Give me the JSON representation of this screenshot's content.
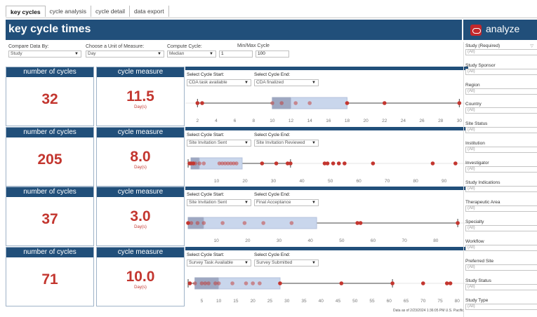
{
  "tabs": [
    "key cycles",
    "cycle analysis",
    "cycle detail",
    "data export"
  ],
  "header": {
    "title": "key cycle times"
  },
  "brand": {
    "name": "analyze"
  },
  "filters": {
    "compare_label": "Compare Data By:",
    "compare_value": "Study",
    "unit_label": "Choose a Unit of Measure:",
    "unit_value": "Day",
    "compute_label": "Compute Cycle:",
    "compute_value": "Median",
    "minmax_label": "Min/Max Cycle",
    "min_value": "1",
    "max_value": "100"
  },
  "labels": {
    "count_header": "number of cycles",
    "measure_header": "cycle measure",
    "unit": "Day(s)",
    "start_label": "Select Cycle Start:",
    "end_label": "Select Cycle End:"
  },
  "rows": [
    {
      "count": "32",
      "measure": "11.5",
      "start": "CDA task available",
      "end": "CDA finalized",
      "axis": {
        "min": 1,
        "max": 30.5,
        "ticks": [
          2,
          4,
          6,
          8,
          10,
          12,
          14,
          16,
          18,
          20,
          22,
          24,
          26,
          28,
          30
        ]
      },
      "box": {
        "whisker_low": 2,
        "q1": 10,
        "median": 12,
        "q3": 18,
        "whisker_high": 30
      },
      "points": [
        {
          "x": 2,
          "o": false
        },
        {
          "x": 2.5,
          "o": false
        },
        {
          "x": 10,
          "o": true
        },
        {
          "x": 11,
          "o": true
        },
        {
          "x": 12.5,
          "o": true
        },
        {
          "x": 14,
          "o": true
        },
        {
          "x": 18,
          "o": false
        },
        {
          "x": 22,
          "o": false
        },
        {
          "x": 30,
          "o": false
        }
      ]
    },
    {
      "count": "205",
      "measure": "8.0",
      "start": "Site Invitation Sent",
      "end": "Site Invitation Reviewed",
      "axis": {
        "min": 0,
        "max": 97,
        "ticks": [
          10,
          20,
          30,
          40,
          50,
          60,
          70,
          80,
          90
        ]
      },
      "box": {
        "whisker_low": 0,
        "q1": 1,
        "median": 4,
        "q3": 19,
        "whisker_high": 36
      },
      "points": [
        {
          "x": 0.5,
          "o": false
        },
        {
          "x": 1,
          "o": false
        },
        {
          "x": 1.8,
          "o": false
        },
        {
          "x": 2.5,
          "o": true
        },
        {
          "x": 4,
          "o": true
        },
        {
          "x": 5.5,
          "o": true
        },
        {
          "x": 11,
          "o": true
        },
        {
          "x": 12,
          "o": true
        },
        {
          "x": 13,
          "o": true
        },
        {
          "x": 14,
          "o": true
        },
        {
          "x": 15,
          "o": true
        },
        {
          "x": 16,
          "o": true
        },
        {
          "x": 17,
          "o": true
        },
        {
          "x": 26,
          "o": false
        },
        {
          "x": 31,
          "o": false
        },
        {
          "x": 35,
          "o": false
        },
        {
          "x": 36,
          "o": false
        },
        {
          "x": 48,
          "o": false
        },
        {
          "x": 49,
          "o": false
        },
        {
          "x": 51,
          "o": false
        },
        {
          "x": 53,
          "o": false
        },
        {
          "x": 55,
          "o": false
        },
        {
          "x": 65,
          "o": false
        },
        {
          "x": 86,
          "o": false
        },
        {
          "x": 94,
          "o": false
        }
      ]
    },
    {
      "count": "37",
      "measure": "3.0",
      "start": "Site Invitation Sent",
      "end": "Final Acceptance",
      "axis": {
        "min": 1,
        "max": 89,
        "ticks": [
          10,
          20,
          30,
          40,
          50,
          60,
          70,
          80
        ]
      },
      "box": {
        "whisker_low": 1,
        "q1": 1,
        "median": 6,
        "q3": 42,
        "whisker_high": 87
      },
      "points": [
        {
          "x": 1,
          "o": false
        },
        {
          "x": 2,
          "o": true
        },
        {
          "x": 4,
          "o": true
        },
        {
          "x": 6,
          "o": true
        },
        {
          "x": 12,
          "o": true
        },
        {
          "x": 19,
          "o": true
        },
        {
          "x": 25,
          "o": true
        },
        {
          "x": 34,
          "o": true
        },
        {
          "x": 55,
          "o": false
        },
        {
          "x": 56,
          "o": false
        },
        {
          "x": 87,
          "o": false
        }
      ]
    },
    {
      "count": "71",
      "measure": "10.0",
      "start": "Survey Task Available",
      "end": "Survey Submitted",
      "axis": {
        "min": 1,
        "max": 82,
        "ticks": [
          5,
          10,
          15,
          20,
          25,
          30,
          35,
          40,
          45,
          50,
          55,
          60,
          65,
          70,
          75,
          80
        ]
      },
      "box": {
        "whisker_low": 1,
        "q1": 3,
        "median": 10,
        "q3": 28,
        "whisker_high": 61
      },
      "points": [
        {
          "x": 1.5,
          "o": false
        },
        {
          "x": 3,
          "o": true
        },
        {
          "x": 5,
          "o": true
        },
        {
          "x": 6,
          "o": true
        },
        {
          "x": 7,
          "o": true
        },
        {
          "x": 9,
          "o": true
        },
        {
          "x": 10,
          "o": true
        },
        {
          "x": 14,
          "o": true
        },
        {
          "x": 18,
          "o": true
        },
        {
          "x": 20,
          "o": true
        },
        {
          "x": 22,
          "o": true
        },
        {
          "x": 28,
          "o": false
        },
        {
          "x": 46,
          "o": false
        },
        {
          "x": 61,
          "o": false
        },
        {
          "x": 70,
          "o": false
        },
        {
          "x": 77,
          "o": false
        },
        {
          "x": 78,
          "o": false
        }
      ]
    }
  ],
  "sidebar": [
    {
      "label": "Study (Required)",
      "value": "(All)"
    },
    {
      "label": "Study Sponsor",
      "value": "(All)"
    },
    {
      "label": "Region",
      "value": "(All)"
    },
    {
      "label": "Country",
      "value": "(All)"
    },
    {
      "label": "Site Status",
      "value": "(All)"
    },
    {
      "label": "Institution",
      "value": "(All)"
    },
    {
      "label": "Investigator",
      "value": "(All)"
    },
    {
      "label": "Study Indications",
      "value": "(All)"
    },
    {
      "label": "Therapeutic Area",
      "value": "(All)"
    },
    {
      "label": "Specialty",
      "value": "(All)"
    },
    {
      "label": "Workflow",
      "value": "(All)"
    },
    {
      "label": "Preferred Site",
      "value": "(All)"
    },
    {
      "label": "Study Status",
      "value": "(All)"
    },
    {
      "label": "Study Type",
      "value": "(All)"
    }
  ],
  "footnote": "Data as of 2/23/2024 1:36:05 PM U.S. Pacific",
  "colors": {
    "accent": "#214f7a",
    "point": "#c3362f",
    "box": "#c9d6ec"
  }
}
